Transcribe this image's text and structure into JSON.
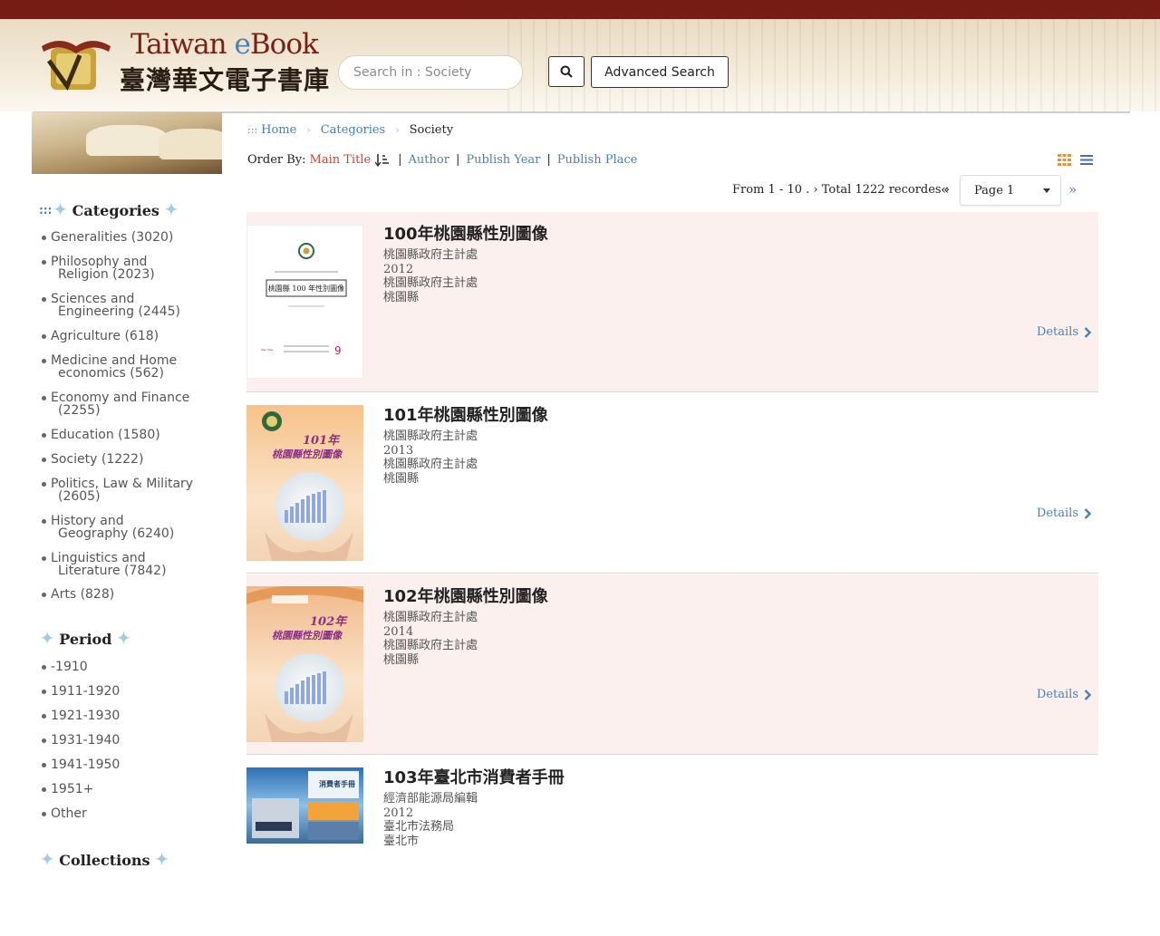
{
  "header": {
    "logo_en_prefix": "Taiwan ",
    "logo_en_e": "e",
    "logo_en_suffix": "Book",
    "logo_zh": "臺灣華文電子書庫",
    "search_placeholder": "Search in : Society",
    "search_icon": "search-icon",
    "advanced_search_label": "Advanced Search"
  },
  "breadcrumb": {
    "prefix": ":::",
    "home": "Home",
    "categories": "Categories",
    "current": "Society"
  },
  "order": {
    "label": "Order By:",
    "active": "Main Title",
    "options": [
      "Author",
      "Publish Year",
      "Publish Place"
    ]
  },
  "pager": {
    "info": "From 1 - 10 . ›  Total 1222 recordes ›",
    "first_symbol": "«",
    "page_value": "Page 1",
    "next_symbol": "»"
  },
  "sidebar": {
    "categories_title": "Categories",
    "categories_prefix": ":::",
    "categories": [
      {
        "line1": "Generalities (3020)",
        "line2": ""
      },
      {
        "line1": "Philosophy and",
        "line2": "Religion (2023)"
      },
      {
        "line1": "Sciences and",
        "line2": "Engineering (2445)"
      },
      {
        "line1": "Agriculture (618)",
        "line2": ""
      },
      {
        "line1": "Medicine and Home",
        "line2": "economics (562)"
      },
      {
        "line1": "Economy and Finance",
        "line2": "(2255)"
      },
      {
        "line1": "Education (1580)",
        "line2": ""
      },
      {
        "line1": "Society (1222)",
        "line2": ""
      },
      {
        "line1": "Politics, Law & Military",
        "line2": "(2605)"
      },
      {
        "line1": "History and",
        "line2": "Geography (6240)"
      },
      {
        "line1": "Linguistics and",
        "line2": "Literature (7842)"
      },
      {
        "line1": "Arts (828)",
        "line2": ""
      }
    ],
    "period_title": "Period",
    "periods": [
      "-1910",
      "1911-1920",
      "1921-1930",
      "1931-1940",
      "1941-1950",
      "1951+",
      "Other"
    ],
    "collections_title": "Collections"
  },
  "results": [
    {
      "title": "100年桃園縣性別圖像",
      "author": "桃園縣政府主計處",
      "year": "2012",
      "publisher": "桃園縣政府主計處",
      "place": "桃園縣",
      "details": "Details"
    },
    {
      "title": "101年桃園縣性別圖像",
      "author": "桃園縣政府主計處",
      "year": "2013",
      "publisher": "桃園縣政府主計處",
      "place": "桃園縣",
      "details": "Details"
    },
    {
      "title": "102年桃園縣性別圖像",
      "author": "桃園縣政府主計處",
      "year": "2014",
      "publisher": "桃園縣政府主計處",
      "place": "桃園縣",
      "details": "Details"
    },
    {
      "title": "103年臺北市消費者手冊",
      "author": "經濟部能源局編輯",
      "year": "2012",
      "publisher": "臺北市法務局",
      "place": "臺北市",
      "details": "Details"
    }
  ],
  "covers": {
    "c1_title": "桃園縣 100 年性別圖像",
    "c2_year": "101年",
    "c2_title": "桃園縣性別圖像",
    "c3_year": "102年",
    "c3_title": "桃園縣性別圖像",
    "c4_title": "消費者手冊"
  },
  "colors": {
    "topbar": "#781b14",
    "link": "#4a7fb3",
    "active_order": "#d8402a",
    "row_highlight": "#fcf0ee"
  }
}
